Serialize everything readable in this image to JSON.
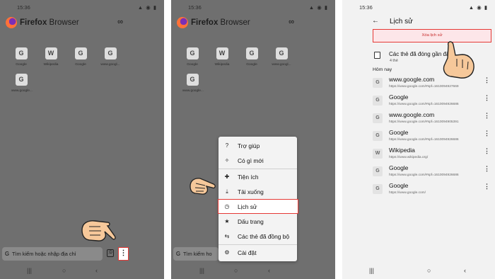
{
  "status_time": "15:36",
  "status_icons": "▲ ◉ ▮",
  "brand": {
    "name_bold": "Firefox",
    "name_rest": " Browser"
  },
  "icons": {
    "mask": "∞",
    "tabs_count": ":D",
    "dots": "⋮"
  },
  "tiles": [
    {
      "letter": "G",
      "label": "Google"
    },
    {
      "letter": "W",
      "label": "Wikipedia"
    },
    {
      "letter": "G",
      "label": "Google"
    },
    {
      "letter": "G",
      "label": "www.googl..."
    },
    {
      "letter": "G",
      "label": "www.google..."
    }
  ],
  "url_bar": {
    "g": "G",
    "placeholder": "Tìm kiếm hoặc nhập địa chỉ"
  },
  "url_bar_short": "Tìm kiếm ho",
  "nav": {
    "recents": "|||",
    "home": "○",
    "back": "‹"
  },
  "menu": [
    {
      "icon": "?",
      "label": "Trợ giúp"
    },
    {
      "icon": "✧",
      "label": "Có gì mới"
    },
    {
      "icon": "✚",
      "label": "Tiện ích"
    },
    {
      "icon": "⤓",
      "label": "Tải xuống"
    },
    {
      "icon": "◷",
      "label": "Lịch sử"
    },
    {
      "icon": "★",
      "label": "Dấu trang"
    },
    {
      "icon": "⇆",
      "label": "Các thẻ đã đồng bộ"
    },
    {
      "icon": "⚙",
      "label": "Cài đặt"
    }
  ],
  "history": {
    "back": "←",
    "title": "Lịch sử",
    "clear_button": "Xóa lịch sử",
    "closed_tabs_title": "Các thẻ đã đóng gần đây",
    "closed_tabs_sub": "4 thẻ",
    "today_label": "Hôm nay",
    "more": "⋮",
    "items": [
      {
        "fav": "G",
        "title": "www.google.com",
        "url": "https://www.google.com/#spf=1610094927669"
      },
      {
        "fav": "G",
        "title": "Google",
        "url": "https://www.google.com/#spf=1610094926686"
      },
      {
        "fav": "G",
        "title": "www.google.com",
        "url": "https://www.google.com/#spf=1610094905391"
      },
      {
        "fav": "G",
        "title": "Google",
        "url": "https://www.google.com/#spf=1610094926686"
      },
      {
        "fav": "W",
        "title": "Wikipedia",
        "url": "https://www.wikipedia.org/"
      },
      {
        "fav": "G",
        "title": "Google",
        "url": "https://www.google.com/#spf=1610094926686"
      },
      {
        "fav": "G",
        "title": "Google",
        "url": "https://www.google.com/"
      }
    ]
  },
  "colors": {
    "highlight": "#e53935",
    "overlay": "#6f6f6f",
    "clear_bg": "#fde6e9"
  }
}
